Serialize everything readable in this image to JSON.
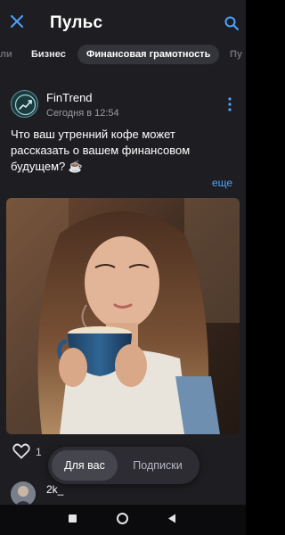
{
  "header": {
    "title": "Пульс",
    "close_icon": "close-icon",
    "search_icon": "search-icon",
    "accent_color": "#4da3ff"
  },
  "tabs": {
    "items": [
      {
        "label": "ли",
        "state": "faded"
      },
      {
        "label": "Бизнес",
        "state": "normal"
      },
      {
        "label": "Финансовая грамотность",
        "state": "active"
      },
      {
        "label": "Пу",
        "state": "faded"
      }
    ]
  },
  "post": {
    "author": "FinTrend",
    "time": "Сегодня в 12:54",
    "text": "Что ваш утренний кофе может рассказать о вашем финансовом будущем? ☕",
    "more_label": "еще",
    "like_count": "1"
  },
  "feed_toggle": {
    "options": [
      "Для вас",
      "Подписки"
    ],
    "selected": "Для вас"
  },
  "next_post": {
    "author": "2k_"
  }
}
